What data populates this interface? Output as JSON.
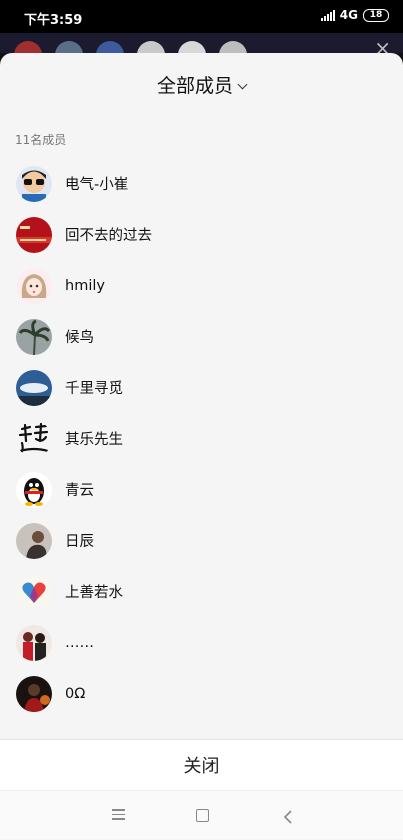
{
  "status_bar": {
    "time": "下午3:59",
    "network": "4G",
    "battery": "18"
  },
  "sheet": {
    "title": "全部成员",
    "member_count": "11名成员",
    "members": [
      {
        "name": "电气-小崔",
        "avatar_icon": "cartoon-avatar-glasses"
      },
      {
        "name": "回不去的过去",
        "avatar_icon": "red-banner-avatar"
      },
      {
        "name": "hmily",
        "avatar_icon": "girl-avatar"
      },
      {
        "name": "候鸟",
        "avatar_icon": "palm-tree-avatar"
      },
      {
        "name": "千里寻觅",
        "avatar_icon": "sky-landscape-avatar"
      },
      {
        "name": "其乐先生",
        "avatar_icon": "calligraphy-avatar"
      },
      {
        "name": "青云",
        "avatar_icon": "penguin-avatar"
      },
      {
        "name": "日辰",
        "avatar_icon": "person-avatar"
      },
      {
        "name": "上善若水",
        "avatar_icon": "heart-avatar"
      },
      {
        "name": "……",
        "avatar_icon": "couple-avatar"
      },
      {
        "name": "0Ω",
        "avatar_icon": "basketball-avatar"
      }
    ],
    "close_label": "关闭"
  },
  "colors": {
    "sheet_bg": "#f5f5f5",
    "footer_bg": "#ffffff",
    "status_bg": "#000000"
  }
}
